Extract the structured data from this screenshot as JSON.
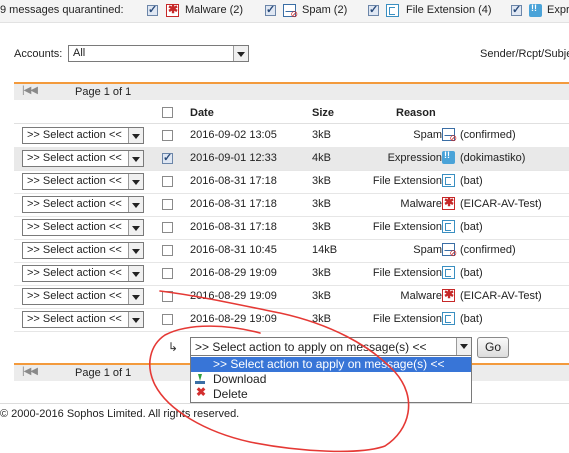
{
  "filter_bar": {
    "label": "9 messages quarantined:",
    "filters": [
      {
        "label": "Malware (2)",
        "checked": true,
        "icon": "malware-icon"
      },
      {
        "label": "Spam (2)",
        "checked": true,
        "icon": "spam-icon"
      },
      {
        "label": "File Extension (4)",
        "checked": true,
        "icon": "file-extension-icon"
      },
      {
        "label": "Expr",
        "checked": true,
        "icon": "expression-icon"
      }
    ]
  },
  "accounts": {
    "label": "Accounts:",
    "value": "All",
    "search_hint": "Sender/Rcpt/Subject"
  },
  "pager_top": {
    "text": "Page 1 of 1"
  },
  "pager_bottom": {
    "text": "Page 1 of 1"
  },
  "table": {
    "headers": {
      "date": "Date",
      "size": "Size",
      "reason": "Reason"
    },
    "rows": [
      {
        "action": ">> Select action <<",
        "checked": false,
        "date": "2016-09-02 13:05",
        "size": "3kB",
        "reason": "Spam",
        "icon": "spam-icon",
        "detail": "(confirmed)"
      },
      {
        "action": ">> Select action <<",
        "checked": true,
        "date": "2016-09-01 12:33",
        "size": "4kB",
        "reason": "Expression",
        "icon": "expression-icon",
        "detail": "(dokimastiko)"
      },
      {
        "action": ">> Select action <<",
        "checked": false,
        "date": "2016-08-31 17:18",
        "size": "3kB",
        "reason": "File Extension",
        "icon": "file-extension-icon",
        "detail": "(bat)"
      },
      {
        "action": ">> Select action <<",
        "checked": false,
        "date": "2016-08-31 17:18",
        "size": "3kB",
        "reason": "Malware",
        "icon": "malware-icon",
        "detail": "(EICAR-AV-Test)"
      },
      {
        "action": ">> Select action <<",
        "checked": false,
        "date": "2016-08-31 17:18",
        "size": "3kB",
        "reason": "File Extension",
        "icon": "file-extension-icon",
        "detail": "(bat)"
      },
      {
        "action": ">> Select action <<",
        "checked": false,
        "date": "2016-08-31 10:45",
        "size": "14kB",
        "reason": "Spam",
        "icon": "spam-icon",
        "detail": "(confirmed)"
      },
      {
        "action": ">> Select action <<",
        "checked": false,
        "date": "2016-08-29 19:09",
        "size": "3kB",
        "reason": "File Extension",
        "icon": "file-extension-icon",
        "detail": "(bat)"
      },
      {
        "action": ">> Select action <<",
        "checked": false,
        "date": "2016-08-29 19:09",
        "size": "3kB",
        "reason": "Malware",
        "icon": "malware-icon",
        "detail": "(EICAR-AV-Test)"
      },
      {
        "action": ">> Select action <<",
        "checked": false,
        "date": "2016-08-29 19:09",
        "size": "3kB",
        "reason": "File Extension",
        "icon": "file-extension-icon",
        "detail": "(bat)"
      }
    ]
  },
  "bulk_action": {
    "corner_glyph": "↳",
    "select_value": ">> Select action to apply on message(s) <<",
    "go_label": "Go",
    "options": [
      {
        "label": ">> Select action to apply on message(s) <<",
        "highlighted": true
      },
      {
        "label": "Download",
        "icon": "download-icon"
      },
      {
        "label": "Delete",
        "icon": "delete-icon"
      }
    ]
  },
  "footer": {
    "copyright": "© 2000-2016 Sophos Limited. All rights reserved."
  },
  "colors": {
    "accent": "#f39a3c",
    "highlight": "#3875d7",
    "annotation": "#e53935"
  }
}
